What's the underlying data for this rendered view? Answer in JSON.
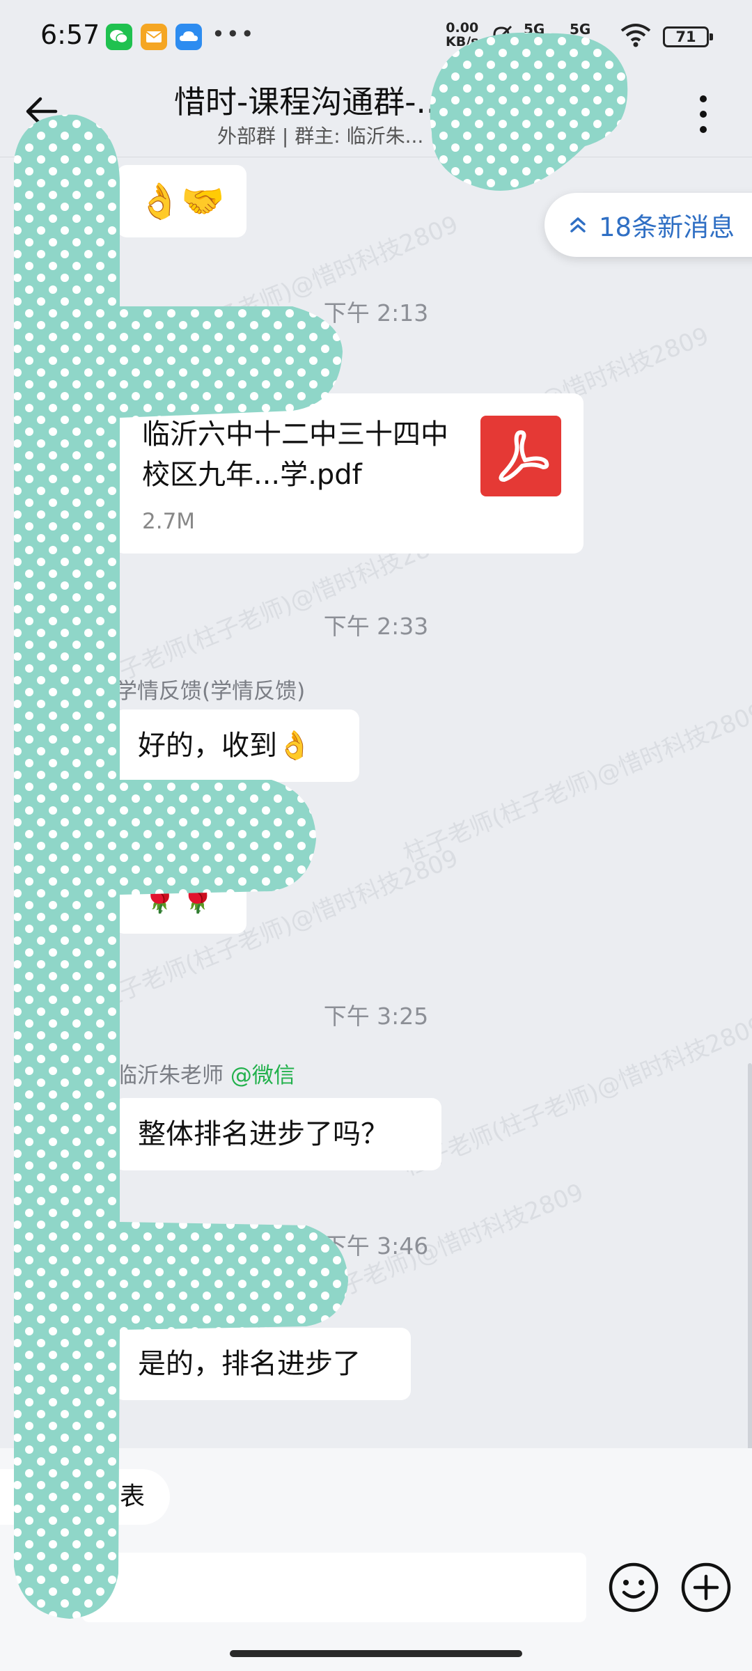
{
  "status_bar": {
    "time": "6:57",
    "more": "•••",
    "net_speed_value": "0.00",
    "net_speed_unit": "KB/s",
    "signal_1": "5G",
    "signal_2": "5G",
    "battery": "71",
    "app_icons": [
      {
        "name": "wechat-icon",
        "color": "#1fc14f"
      },
      {
        "name": "mail-icon",
        "color": "#f5a623"
      },
      {
        "name": "cloud-icon",
        "color": "#2d8cf0"
      }
    ]
  },
  "header": {
    "title": "惜时-课程沟通群-...",
    "subtitle": "外部群 | 群主: 临沂朱..."
  },
  "new_messages": {
    "label": "18条新消息"
  },
  "messages": {
    "m1": {
      "emoji": "👌🤝"
    },
    "t1": "下午 2:13",
    "file": {
      "name": "临沂六中十二中三十四中校区九年...学.pdf",
      "size": "2.7M"
    },
    "t2": "下午 2:33",
    "m2": {
      "sender": "学情反馈(学情反馈)",
      "text": "好的，收到👌"
    },
    "m3": {
      "emoji": "🌹🌹"
    },
    "t3": "下午 3:25",
    "m4": {
      "sender": "临沂朱老师",
      "sender_tag": "@微信",
      "text": "整体排名进步了吗？"
    },
    "t4": "下午 3:46",
    "m5": {
      "text": "是的，排名进步了"
    }
  },
  "watermark_text": "柱子老师(柱子老师)@惜时科技2809",
  "quick_bar": {
    "chip": "收集表"
  },
  "input": {
    "placeholder": ""
  },
  "colors": {
    "background": "#ebedf1",
    "bubble": "#ffffff",
    "accent_blue": "#2f6fc4",
    "tag_green": "#22b14c",
    "pdf_red": "#e53935",
    "redaction_teal": "#8fd6c8"
  }
}
